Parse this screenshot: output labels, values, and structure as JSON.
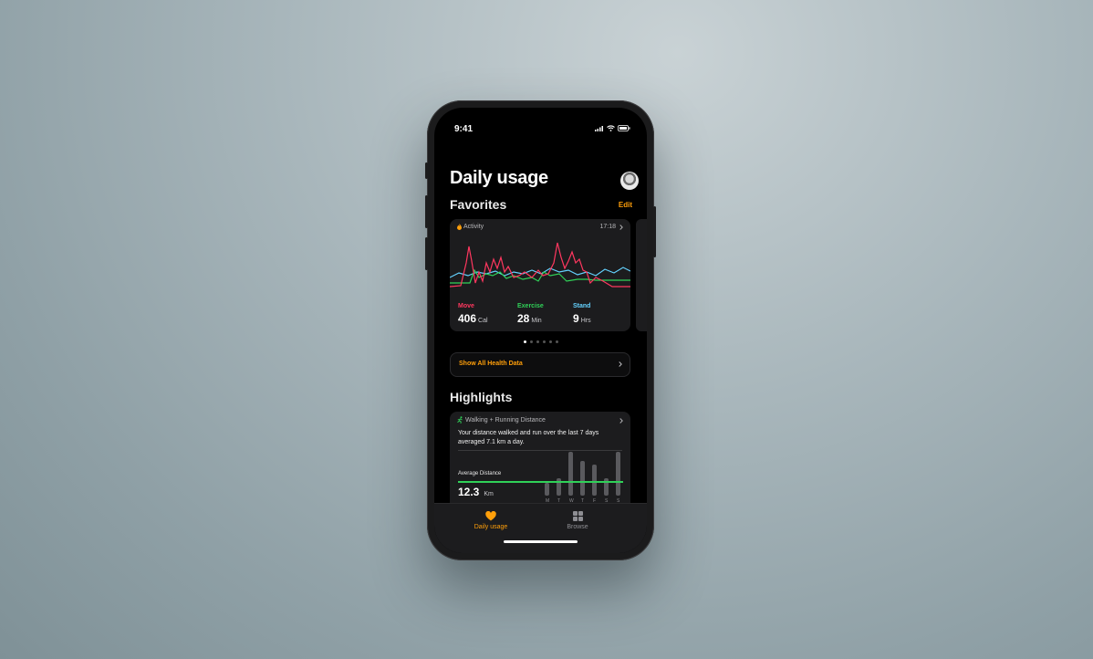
{
  "status": {
    "time": "9:41"
  },
  "header": {
    "title": "Daily usage"
  },
  "favorites": {
    "heading": "Favorites",
    "edit_label": "Edit"
  },
  "activity": {
    "title": "Activity",
    "time": "17:18",
    "metrics": [
      {
        "label": "Move",
        "value": "406",
        "unit": "Cal",
        "color": "#ff375f"
      },
      {
        "label": "Exercise",
        "value": "28",
        "unit": "Min",
        "color": "#30d158"
      },
      {
        "label": "Stand",
        "value": "9",
        "unit": "Hrs",
        "color": "#64d2ff"
      }
    ]
  },
  "pager": {
    "count": 6,
    "active": 0
  },
  "show_all": {
    "label": "Show All Health Data"
  },
  "highlights": {
    "heading": "Highlights",
    "title": "Walking + Running Distance",
    "description": "Your distance walked and run over the last 7 days averaged 7.1 km a day.",
    "avg_label": "Average Distance",
    "avg_value": "12.3",
    "avg_unit": "Km",
    "days": [
      "M",
      "T",
      "W",
      "T",
      "F",
      "S",
      "S"
    ],
    "daily_distances": [
      3,
      4,
      10,
      8,
      7,
      4,
      10
    ],
    "average_line": 5
  },
  "tabbar": {
    "tabs": [
      {
        "label": "Daily usage",
        "active": true
      },
      {
        "label": "Browse",
        "active": false
      }
    ]
  },
  "colors": {
    "accent": "#ff9f0a",
    "move": "#ff375f",
    "exercise": "#30d158",
    "stand": "#64d2ff",
    "walk": "#30d158"
  }
}
